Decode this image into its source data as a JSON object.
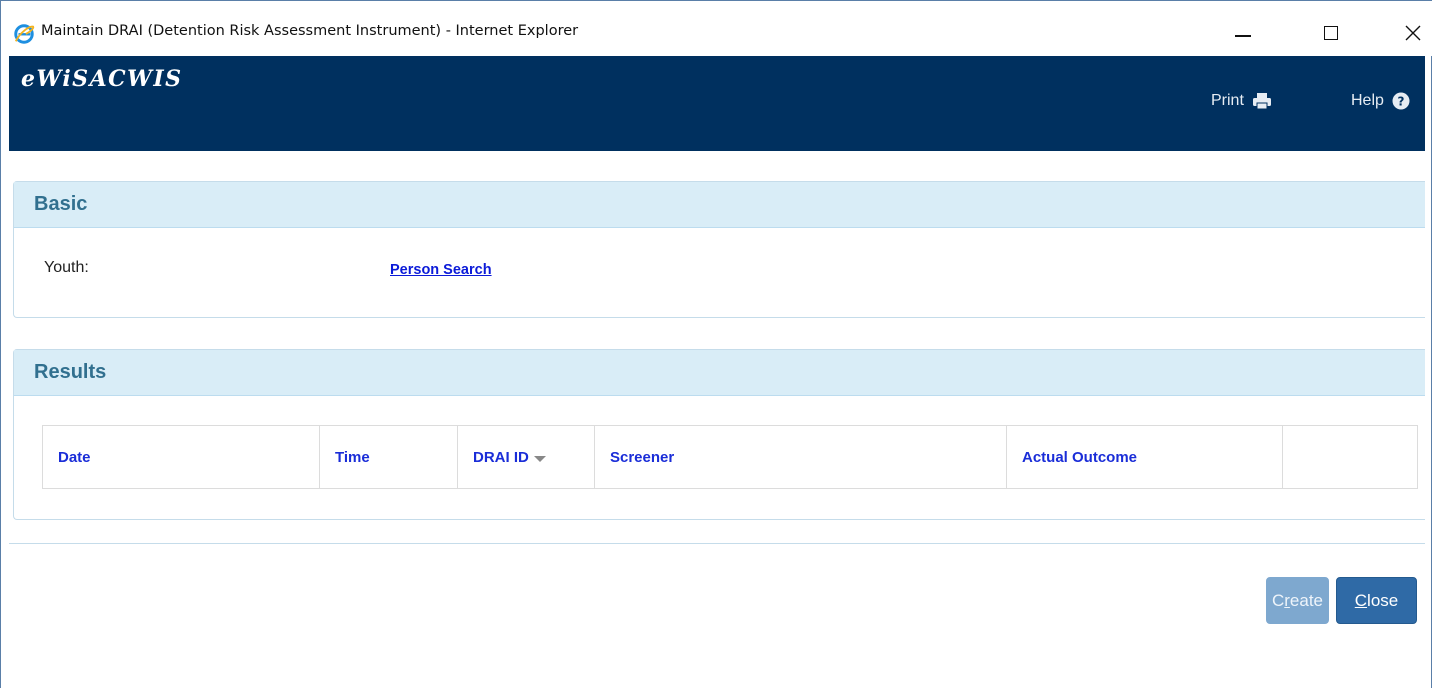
{
  "window": {
    "title": "Maintain DRAI (Detention Risk Assessment Instrument) - Internet Explorer",
    "browser_icon": "internet-explorer-icon",
    "controls": [
      "minimize-icon",
      "maximize-icon",
      "close-icon"
    ]
  },
  "header": {
    "brand": "eWiSACWIS",
    "print_label": "Print",
    "print_icon": "printer-icon",
    "help_label": "Help",
    "help_icon": "question-circle-icon",
    "background": "#00305f"
  },
  "basic": {
    "title": "Basic",
    "youth_label": "Youth:",
    "person_search_link": "Person Search"
  },
  "results": {
    "title": "Results",
    "columns": [
      "Date",
      "Time",
      "DRAI ID",
      "Screener",
      "Actual Outcome",
      ""
    ],
    "sorted_column": "DRAI ID"
  },
  "buttons": {
    "create_prefix": "C",
    "create_accel": "r",
    "create_suffix": "eate",
    "close_accel": "C",
    "close_suffix": "lose"
  },
  "colors": {
    "section_header_bg": "#d9edf7",
    "section_header_text": "#31708f",
    "link": "#0b1ad8",
    "primary_button": "#2f6aa6",
    "disabled_button": "#7ea8cf"
  }
}
